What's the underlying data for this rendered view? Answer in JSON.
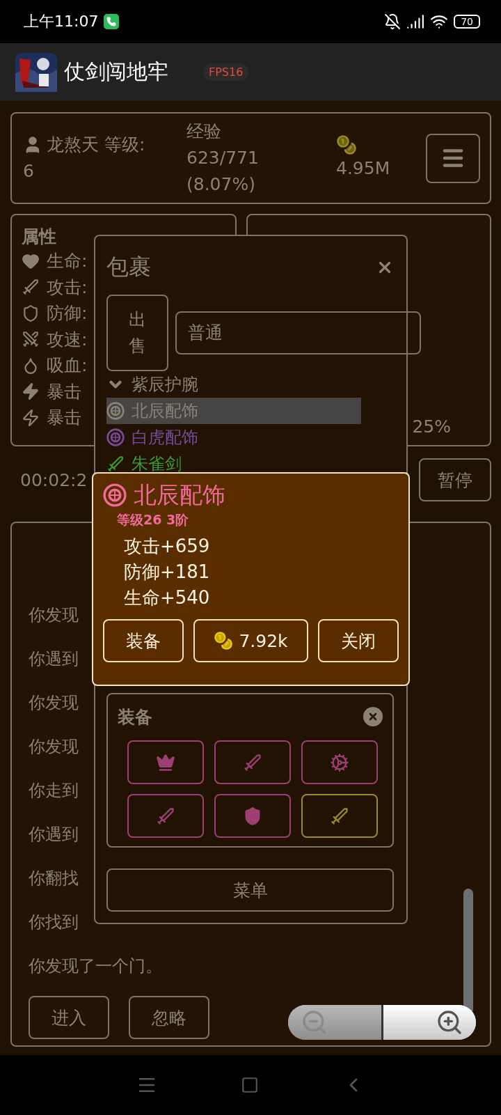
{
  "status_bar": {
    "time": "上午11:07",
    "battery": "70"
  },
  "app_bar": {
    "title": "仗剑闯地牢",
    "fps": "FPS16"
  },
  "player": {
    "name": "龙熬天 等级:",
    "level": "6",
    "exp_label": "经验",
    "exp": "623/771",
    "exp_percent": "(8.07%)",
    "gold": "4.95M"
  },
  "attributes": {
    "title": "属性",
    "rows": [
      {
        "kind": "heart",
        "label": "生命:"
      },
      {
        "kind": "sword",
        "label": "攻击:"
      },
      {
        "kind": "shield",
        "label": "防御:"
      },
      {
        "kind": "speed",
        "label": "攻速:"
      },
      {
        "kind": "drain",
        "label": "吸血:"
      },
      {
        "kind": "bolt",
        "label": "暴击"
      },
      {
        "kind": "crit",
        "label": "暴击"
      }
    ]
  },
  "bonus": {
    "value": "25%"
  },
  "timer": {
    "time": "00:02:2",
    "pause_button": "暂停"
  },
  "log": {
    "lines": [
      "你发现",
      "你遇到",
      "你发现",
      "你发现",
      "你走到",
      "你遇到",
      "你翻找",
      "你找到"
    ],
    "last": "你发现了一个门。",
    "actions": [
      "进入",
      "忽略"
    ]
  },
  "bag": {
    "title": "包裹",
    "sell_button": "出售",
    "filter": "普通",
    "items": [
      {
        "name": "紫辰护腕",
        "kind": "bracer",
        "color": "#8b8275",
        "selected": false
      },
      {
        "name": "北辰配饰",
        "kind": "ornament",
        "color": "#8b8275",
        "selected": true
      },
      {
        "name": "白虎配饰",
        "kind": "ornament",
        "color": "#7a4a9a",
        "selected": false
      },
      {
        "name": "朱雀剑",
        "kind": "sword",
        "color": "#3f9a2e",
        "selected": false
      }
    ],
    "equipment": {
      "title": "装备",
      "slots": [
        {
          "kind": "helmet",
          "color": "#9c3f72"
        },
        {
          "kind": "sword",
          "color": "#9c3f72"
        },
        {
          "kind": "gear",
          "color": "#9c3f72"
        },
        {
          "kind": "dagger",
          "color": "#9c3f72"
        },
        {
          "kind": "shield",
          "color": "#9c3f72"
        },
        {
          "kind": "blade",
          "color": "#9a8a22"
        }
      ]
    },
    "menu_button": "菜单"
  },
  "item_popup": {
    "name": "北辰配饰",
    "info": "等级26 3阶",
    "stats": [
      "攻击+659",
      "防御+181",
      "生命+540"
    ],
    "buttons": [
      {
        "kind": "text",
        "label": "装备"
      },
      {
        "kind": "price",
        "label": "7.92k"
      },
      {
        "kind": "text",
        "label": "关闭"
      }
    ]
  }
}
